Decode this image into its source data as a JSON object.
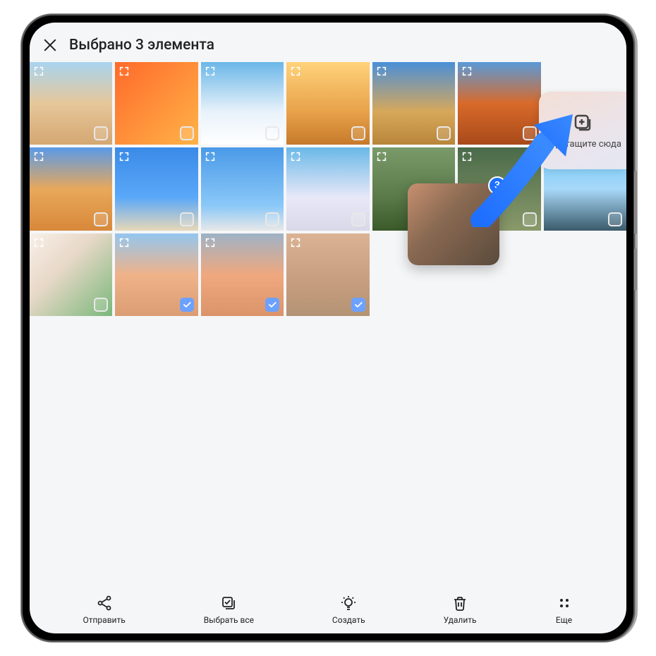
{
  "header": {
    "title": "Выбрано 3 элемента"
  },
  "drop_zone": {
    "label": "Перетащите сюда"
  },
  "drag_badge": "3",
  "grid": {
    "rows": [
      [
        {
          "bg": "linear-gradient(180deg,#a8d4ef 0%,#e6c79a 50%,#d4a772 100%)",
          "accent": "#e85a12",
          "selected": false,
          "exists": true
        },
        {
          "bg": "linear-gradient(135deg,#ff6a2b 0%,#ffb347 100%)",
          "accent": "#ffd34d",
          "selected": false,
          "exists": true
        },
        {
          "bg": "linear-gradient(180deg,#6bb7e8 0%,#e8f2fa 60%,#fff 100%)",
          "accent": "#2a4a8a",
          "selected": false,
          "exists": true
        },
        {
          "bg": "linear-gradient(180deg,#ffd27a 0%,#e8a24a 60%,#c67a2a 100%)",
          "accent": "#a8622a",
          "selected": false,
          "exists": true
        },
        {
          "bg": "linear-gradient(180deg,#4a8fd8 0%,#d8a85a 60%,#b8863a 100%)",
          "accent": "#3a6aa8",
          "selected": false,
          "exists": true
        },
        {
          "bg": "linear-gradient(180deg,#5a9ad8 0%,#d86a2a 50%,#a84a1a 100%)",
          "accent": "#c85a1a",
          "selected": false,
          "exists": true
        },
        {
          "bg": "",
          "accent": "",
          "selected": false,
          "exists": false
        }
      ],
      [
        {
          "bg": "linear-gradient(180deg,#5a9ae8 0%,#e8a85a 50%,#d8883a 100%)",
          "accent": "#c87a2a",
          "selected": false,
          "exists": true
        },
        {
          "bg": "linear-gradient(180deg,#3a8ae8 0%,#5aa8f8 60%,#e8d8b8 100%)",
          "accent": "#e87a3a",
          "selected": false,
          "exists": true
        },
        {
          "bg": "linear-gradient(180deg,#4a9ae8 0%,#8ac8f8 70%,#e8e8e8 100%)",
          "accent": "#6ab8e8",
          "selected": false,
          "exists": true
        },
        {
          "bg": "linear-gradient(180deg,#6ab8e8 0%,#e8e8f8 60%,#d8d8e8 100%)",
          "accent": "#e87a2a",
          "selected": false,
          "exists": true
        },
        {
          "bg": "linear-gradient(180deg,#7a9a6a 0%,#5a7a4a 60%,#3a5a2a 100%)",
          "accent": "#4a6a3a",
          "selected": false,
          "exists": true
        },
        {
          "bg": "linear-gradient(180deg,#4a6a4a 0%,#8a9a6a 100%)",
          "accent": "#5a7a4a",
          "selected": false,
          "exists": true
        },
        {
          "bg": "linear-gradient(180deg,#6ac8f8 0%,#a8d8f8 50%,#3a5a6a 100%)",
          "accent": "#5a9ad8",
          "selected": false,
          "exists": true
        }
      ],
      [
        {
          "bg": "linear-gradient(135deg,#f8f0e8 0%,#e8d8c8 40%,#7ab87a 100%)",
          "accent": "#d8c8b8",
          "selected": false,
          "exists": true
        },
        {
          "bg": "linear-gradient(180deg,#5aa8e8 0%,#e88a4a 50%,#c86a2a 100%)",
          "accent": "#d87a3a",
          "selected": true,
          "exists": true
        },
        {
          "bg": "linear-gradient(180deg,#6a8aa8 0%,#e87a3a 50%,#c85a1a 100%)",
          "accent": "#d86a2a",
          "selected": true,
          "exists": true
        },
        {
          "bg": "linear-gradient(180deg,#c88a5a 0%,#a86a3a 60%,#8a5a2a 100%)",
          "accent": "#b87a4a",
          "selected": true,
          "exists": true
        },
        {
          "bg": "",
          "accent": "",
          "selected": false,
          "exists": false
        },
        {
          "bg": "",
          "accent": "",
          "selected": false,
          "exists": false
        },
        {
          "bg": "",
          "accent": "",
          "selected": false,
          "exists": false
        }
      ]
    ]
  },
  "bottom": {
    "send": "Отправить",
    "select_all": "Выбрать все",
    "create": "Создать",
    "delete": "Удалить",
    "more": "Еще"
  }
}
